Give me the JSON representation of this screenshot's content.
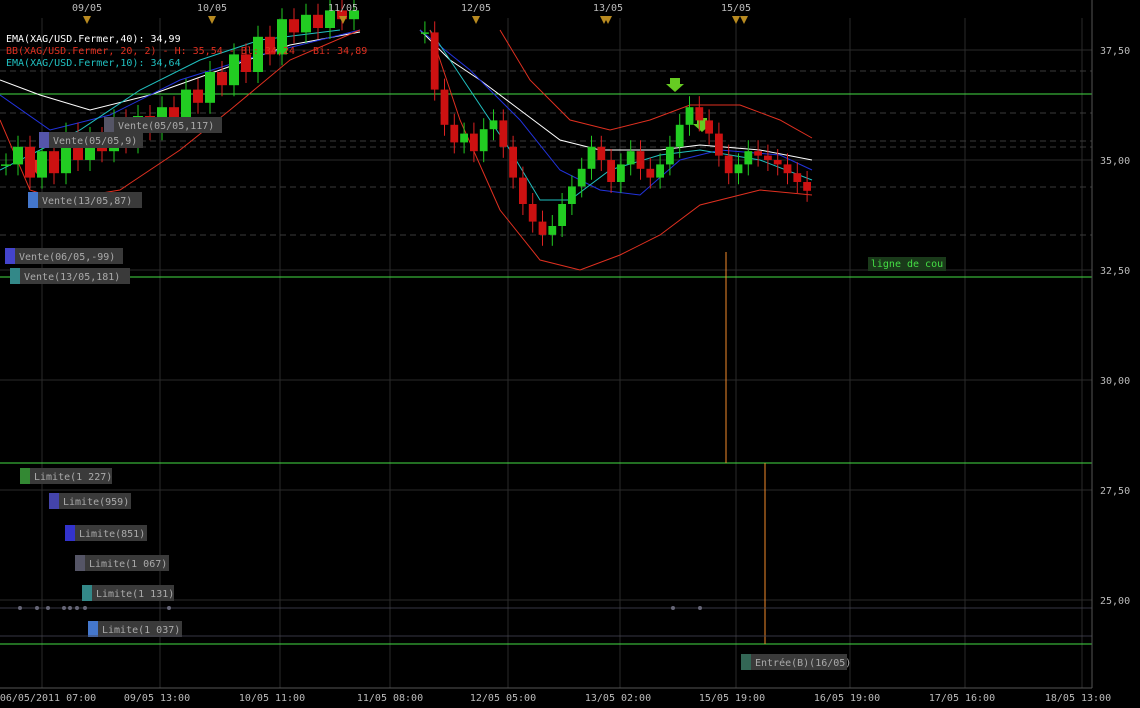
{
  "chart_data": {
    "type": "candlestick",
    "symbol": "XAG/USD",
    "ylim": [
      23.8,
      38.4
    ],
    "y_ticks": [
      "37,50",
      "35,00",
      "32,50",
      "30,00",
      "27,50",
      "25,00"
    ],
    "x_top_labels": [
      "09/05",
      "10/05",
      "11/05",
      "12/05",
      "13/05",
      "15/05"
    ],
    "x_bottom_labels": [
      "06/05/2011 07:00",
      "09/05 13:00",
      "10/05 11:00",
      "11/05 08:00",
      "12/05 05:00",
      "13/05 02:00",
      "15/05 19:00",
      "16/05 19:00",
      "17/05 16:00",
      "18/05 13:00"
    ],
    "legend": [
      {
        "text": "EMA(XAG/USD.Fermer,40): 34,99",
        "color": "#ffffff"
      },
      {
        "text": "BB(XAG/USD.Fermer, 20, 2) - H: 35,54 - Bl: 34,24 - Bi: 34,89",
        "color": "#e03020"
      },
      {
        "text": "EMA(XAG/USD.Fermer,10): 34,64",
        "color": "#20c0c0"
      }
    ],
    "h_lines": [
      {
        "value": 36.51,
        "label": "36,51",
        "color": "#44dd44"
      },
      {
        "value": 33.34,
        "label": "33,34",
        "color": "#44dd44"
      },
      {
        "value": 28.13,
        "label": "28,13",
        "color": "#44dd44"
      },
      {
        "value": 24.0,
        "label": "24,00",
        "color": "#44dd44"
      }
    ],
    "current_price": {
      "value": 34.3,
      "label": "34,30"
    },
    "orders": [
      {
        "text": "Vente(05/05,117)",
        "color": "#555566"
      },
      {
        "text": "Vente(05/05,9)",
        "color": "#5555aa"
      },
      {
        "text": "Vente(13/05,87)",
        "color": "#4477cc"
      },
      {
        "text": "Vente(06/05,-99)",
        "color": "#4444cc"
      },
      {
        "text": "Vente(13/05,181)",
        "color": "#338888"
      },
      {
        "text": "Limite(1 227)",
        "color": "#338833"
      },
      {
        "text": "Limite(959)",
        "color": "#4444aa"
      },
      {
        "text": "Limite(851)",
        "color": "#3333cc"
      },
      {
        "text": "Limite(1 067)",
        "color": "#555566"
      },
      {
        "text": "Limite(1 131)",
        "color": "#338888"
      },
      {
        "text": "Limite(1 037)",
        "color": "#4477cc"
      },
      {
        "text": "Entrée(B)(16/05)",
        "color": "#336655"
      }
    ],
    "annotation": "ligne de cou",
    "candles": [
      34.9,
      35.3,
      34.6,
      35.2,
      34.7,
      35.6,
      35.0,
      35.5,
      35.2,
      35.9,
      35.4,
      36.0,
      35.7,
      36.2,
      35.9,
      36.6,
      36.3,
      37.0,
      36.7,
      37.4,
      37.0,
      37.8,
      37.4,
      38.2,
      37.9,
      38.3,
      38.0,
      38.4,
      38.2,
      38.4,
      37.9,
      36.6,
      35.8,
      35.4,
      35.6,
      35.2,
      35.7,
      35.9,
      35.3,
      34.6,
      34.0,
      33.6,
      33.3,
      33.5,
      34.0,
      34.4,
      34.8,
      35.3,
      35.0,
      34.5,
      34.9,
      35.2,
      34.8,
      34.6,
      34.9,
      35.3,
      35.8,
      36.2,
      35.9,
      35.6,
      35.1,
      34.7,
      34.9,
      35.2,
      35.1,
      35.0,
      34.9,
      34.7,
      34.5,
      34.3
    ]
  }
}
